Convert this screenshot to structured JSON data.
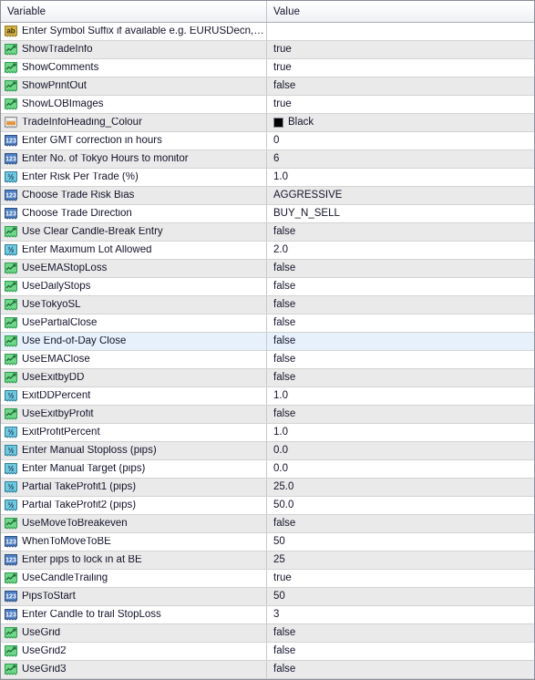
{
  "panel": {
    "columns": {
      "variable_header": "Variable",
      "value_header": "Value"
    }
  },
  "colors": {
    "bool_icon_fill": "#6fd68a",
    "int_icon_fill": "#4f7fc4",
    "double_icon_fill": "#6fc8e0",
    "string_icon_fill": "#d4b24a",
    "color_icon_fill": "#e8923a",
    "row_alt": "#eaeaea",
    "row_selected": "#e6f1fb",
    "swatch_black": "#000000"
  },
  "rows": [
    {
      "icon": "string-type-icon",
      "name": "Enter Symbol Suffix if available e.g. EURUSDecn, ent…",
      "value": ""
    },
    {
      "icon": "boolean-type-icon",
      "name": "ShowTradeInfo",
      "value": "true"
    },
    {
      "icon": "boolean-type-icon",
      "name": "ShowComments",
      "value": "true"
    },
    {
      "icon": "boolean-type-icon",
      "name": "ShowPrintOut",
      "value": "false"
    },
    {
      "icon": "boolean-type-icon",
      "name": "ShowLOBImages",
      "value": "true"
    },
    {
      "icon": "color-type-icon",
      "name": "TradeInfoHeading_Colour",
      "value": "Black",
      "swatch": "#000000"
    },
    {
      "icon": "integer-type-icon",
      "name": "Enter GMT correction in hours",
      "value": "0"
    },
    {
      "icon": "integer-type-icon",
      "name": "Enter No. of Tokyo Hours to monitor",
      "value": "6"
    },
    {
      "icon": "double-type-icon",
      "name": "Enter Risk Per Trade (%)",
      "value": "1.0"
    },
    {
      "icon": "integer-type-icon",
      "name": "Choose Trade Risk Bias",
      "value": "AGGRESSIVE"
    },
    {
      "icon": "integer-type-icon",
      "name": "Choose Trade Direction",
      "value": "BUY_N_SELL"
    },
    {
      "icon": "boolean-type-icon",
      "name": "Use Clear Candle-Break Entry",
      "value": "false"
    },
    {
      "icon": "double-type-icon",
      "name": "Enter Maximum Lot Allowed",
      "value": "2.0"
    },
    {
      "icon": "boolean-type-icon",
      "name": "UseEMAStopLoss",
      "value": "false"
    },
    {
      "icon": "boolean-type-icon",
      "name": "UseDailyStops",
      "value": "false"
    },
    {
      "icon": "boolean-type-icon",
      "name": "UseTokyoSL",
      "value": "false"
    },
    {
      "icon": "boolean-type-icon",
      "name": "UsePartialClose",
      "value": "false"
    },
    {
      "icon": "boolean-type-icon",
      "name": "Use End-of-Day Close",
      "value": "false",
      "selected": true
    },
    {
      "icon": "boolean-type-icon",
      "name": "UseEMAClose",
      "value": "false"
    },
    {
      "icon": "boolean-type-icon",
      "name": "UseExitbyDD",
      "value": "false"
    },
    {
      "icon": "double-type-icon",
      "name": "ExitDDPercent",
      "value": "1.0"
    },
    {
      "icon": "boolean-type-icon",
      "name": "UseExitbyProfit",
      "value": "false"
    },
    {
      "icon": "double-type-icon",
      "name": "ExitProfitPercent",
      "value": "1.0"
    },
    {
      "icon": "double-type-icon",
      "name": "Enter Manual Stoploss (pips)",
      "value": "0.0"
    },
    {
      "icon": "double-type-icon",
      "name": "Enter Manual Target (pips)",
      "value": "0.0"
    },
    {
      "icon": "double-type-icon",
      "name": "Partial TakeProfit1 (pips)",
      "value": "25.0"
    },
    {
      "icon": "double-type-icon",
      "name": "Partial TakeProfit2 (pips)",
      "value": "50.0"
    },
    {
      "icon": "boolean-type-icon",
      "name": "UseMoveToBreakeven",
      "value": "false"
    },
    {
      "icon": "integer-type-icon",
      "name": "WhenToMoveToBE",
      "value": "50"
    },
    {
      "icon": "integer-type-icon",
      "name": "Enter pips to lock in at BE",
      "value": "25"
    },
    {
      "icon": "boolean-type-icon",
      "name": "UseCandleTrailing",
      "value": "true"
    },
    {
      "icon": "integer-type-icon",
      "name": "PipsToStart",
      "value": "50"
    },
    {
      "icon": "integer-type-icon",
      "name": "Enter Candle to trail StopLoss",
      "value": "3"
    },
    {
      "icon": "boolean-type-icon",
      "name": "UseGrid",
      "value": "false"
    },
    {
      "icon": "boolean-type-icon",
      "name": "UseGrid2",
      "value": "false"
    },
    {
      "icon": "boolean-type-icon",
      "name": "UseGrid3",
      "value": "false"
    }
  ]
}
